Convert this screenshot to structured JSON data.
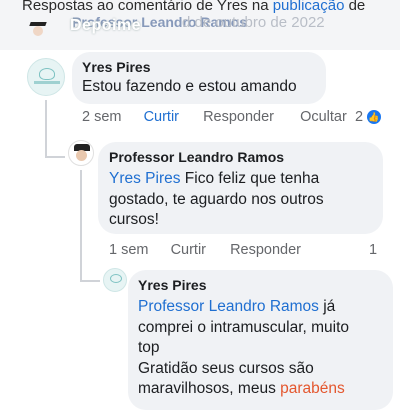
{
  "header": {
    "line1_prefix": "Respostas ao comentário de Yres na ",
    "line1_link": "publicação",
    "line1_suffix": " de",
    "line2_name": "Professor Leandro Ramos",
    "overlay_text": "Depoime",
    "line2_date": "d de outubro de 2022"
  },
  "comments": [
    {
      "author": "Yres Pires",
      "text": "Estou fazendo e estou amando",
      "actions": {
        "time": "2 sem",
        "like": "Curtir",
        "reply": "Responder",
        "hide": "Ocultar",
        "reactions": "2"
      }
    },
    {
      "author": "Professor Leandro Ramos",
      "mention": "Yres Pires",
      "text_line1": " Fico feliz que tenha",
      "text_line2": "gostado, te aguardo nos outros",
      "text_line3": "cursos!",
      "actions": {
        "time": "1 sem",
        "like": "Curtir",
        "reply": "Responder",
        "reactions": "1"
      }
    },
    {
      "author": "Yres Pires",
      "mention": "Professor Leandro Ramos",
      "text_line1_suffix": " já",
      "text_line2": "comprei o intramuscular, muito",
      "text_line3": "top",
      "text_line4": "Gratidão seus cursos são",
      "text_line5_prefix": "maravilhosos, meus ",
      "text_line5_highlight": "parabéns"
    }
  ],
  "colors": {
    "link": "#1f6fd1",
    "highlight": "#e4572e",
    "bubble": "#f0f2f5",
    "muted": "#65676b"
  }
}
